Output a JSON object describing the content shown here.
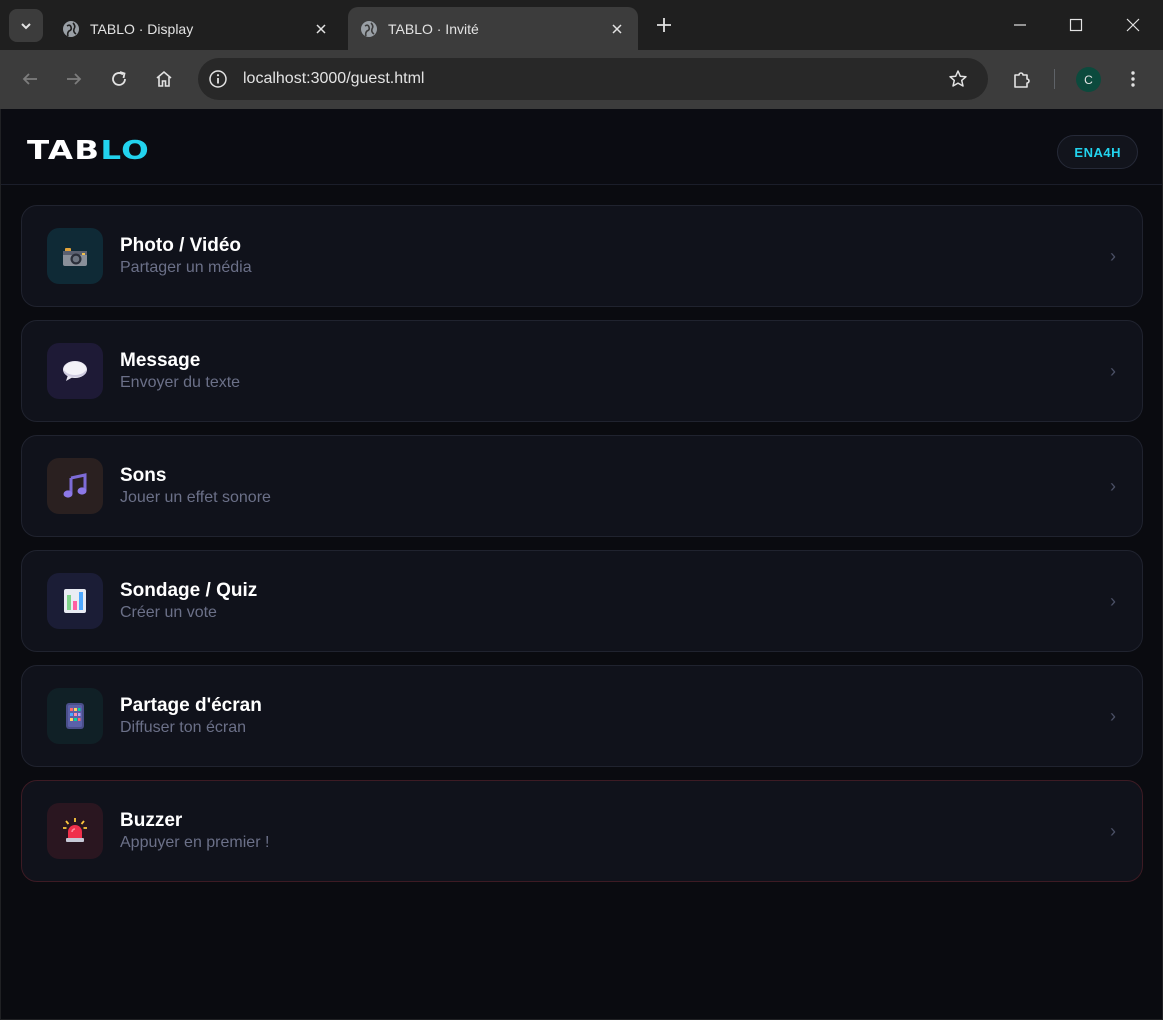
{
  "browser": {
    "tabs": [
      {
        "title": "TABLO · Display",
        "active": false
      },
      {
        "title": "TABLO · Invité",
        "active": true
      }
    ],
    "url": "localhost:3000/guest.html",
    "profile_initial": "C"
  },
  "header": {
    "logo_part1": "TAB",
    "logo_part2": "LO",
    "room_code": "ENA4H"
  },
  "actions": [
    {
      "title": "Photo / Vidéo",
      "subtitle": "Partager un média",
      "icon": "camera-icon",
      "bg": "#0f2a36"
    },
    {
      "title": "Message",
      "subtitle": "Envoyer du texte",
      "icon": "speech-bubble-icon",
      "bg": "#1e1a36"
    },
    {
      "title": "Sons",
      "subtitle": "Jouer un effet sonore",
      "icon": "music-note-icon",
      "bg": "#2a2020"
    },
    {
      "title": "Sondage / Quiz",
      "subtitle": "Créer un vote",
      "icon": "bar-chart-icon",
      "bg": "#1b1d36"
    },
    {
      "title": "Partage d'écran",
      "subtitle": "Diffuser ton écran",
      "icon": "phone-screen-icon",
      "bg": "#102026"
    },
    {
      "title": "Buzzer",
      "subtitle": "Appuyer en premier !",
      "icon": "siren-icon",
      "bg": "#2a1620"
    }
  ],
  "colors": {
    "accent": "#22d3ee",
    "background": "#0a0b10",
    "card": "#10121b",
    "buzzer_border": "#3d1b24"
  }
}
